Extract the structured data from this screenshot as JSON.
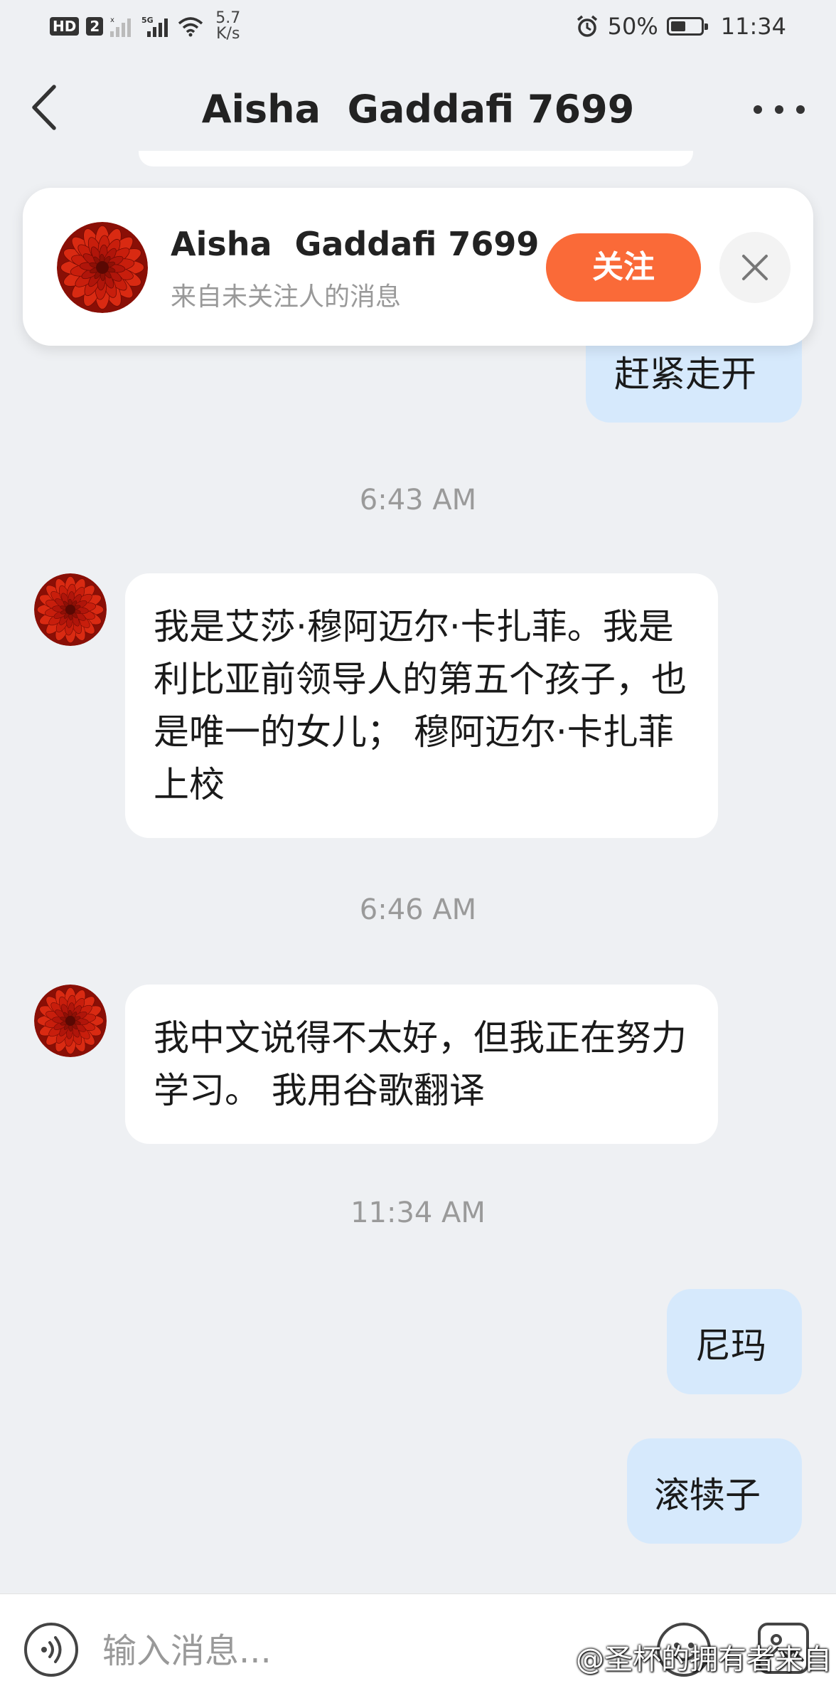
{
  "status_bar": {
    "hd": "HD",
    "sim": "2",
    "net_speed_value": "5.7",
    "net_speed_unit": "K/s",
    "battery_text": "50%",
    "battery_level": 0.5,
    "time": "11:34"
  },
  "header": {
    "title": "Aisha  Gaddafi 7699",
    "back_icon": "back-chevron-icon",
    "more_icon": "more-dots-icon"
  },
  "follow_card": {
    "name": "Aisha  Gaddafi 7699",
    "subtitle": "来自未关注人的消息",
    "follow_label": "关注",
    "close_icon": "close-icon"
  },
  "messages": {
    "out_1": "赶紧走开",
    "ts_1": "6:43 AM",
    "in_1": "我是艾莎·穆阿迈尔·卡扎菲。我是利比亚前领导人的第五个孩子，也是唯一的女儿； 穆阿迈尔·卡扎菲上校",
    "ts_2": "6:46 AM",
    "in_2": "我中文说得不太好，但我正在努力学习。 我用谷歌翻译",
    "ts_3": "11:34 AM",
    "out_2": "尼玛",
    "out_3": "滚犊子"
  },
  "input_bar": {
    "placeholder": "输入消息...",
    "voice_icon": "voice-icon",
    "emoji_icon": "emoji-icon",
    "image_icon": "image-icon"
  },
  "watermark": "@圣杯的拥有者来自",
  "colors": {
    "accent": "#fa6a38",
    "outgoing_bubble": "#d6e9fc",
    "background": "#eef0f3",
    "avatar_red": "#c81e0c"
  }
}
